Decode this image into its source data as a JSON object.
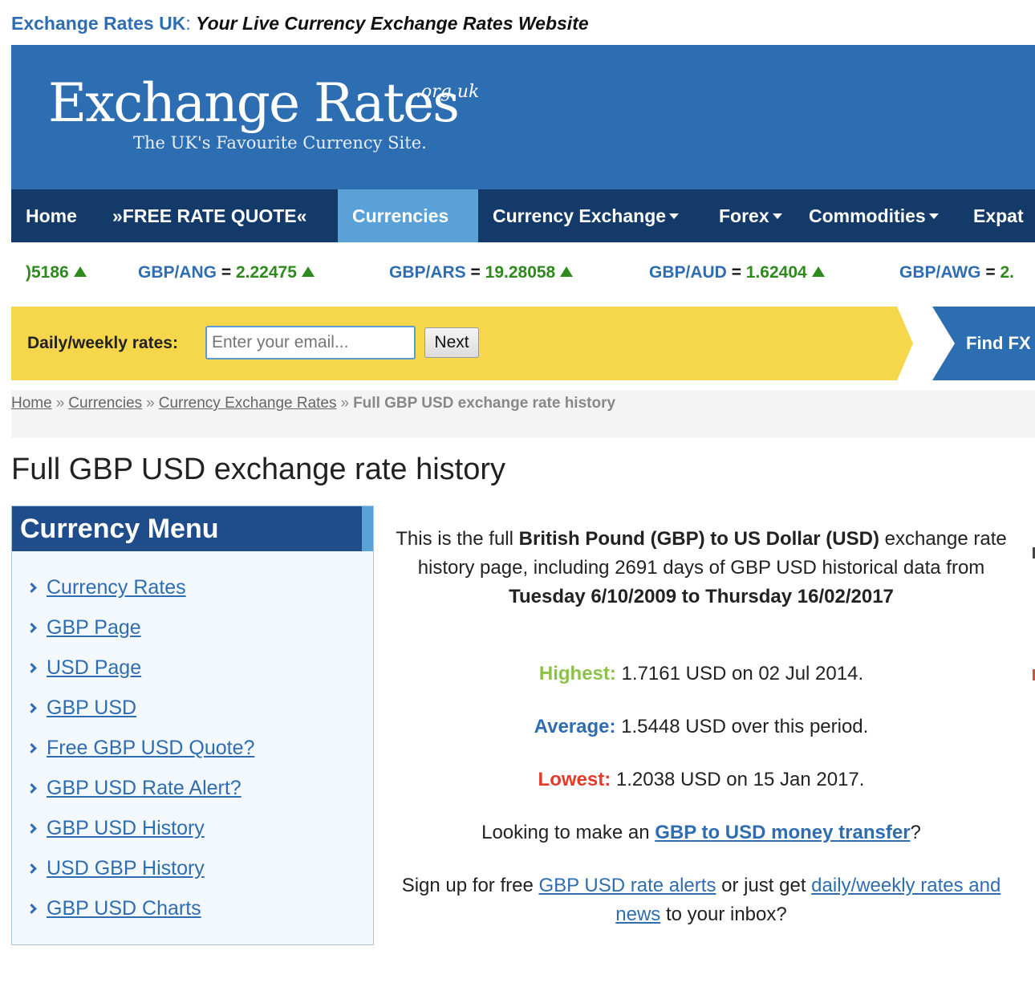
{
  "topline": {
    "site": "Exchange Rates UK",
    "colon": ":",
    "tagline": "Your Live Currency Exchange Rates Website"
  },
  "logo": {
    "main": "Exchange Rates",
    "sup": ".org.uk",
    "sub": "The UK's  Favourite Currency Site."
  },
  "nav": [
    {
      "label": "Home",
      "dropdown": false,
      "active": false
    },
    {
      "label": "»FREE RATE QUOTE«",
      "dropdown": false,
      "active": false
    },
    {
      "label": "Currencies",
      "dropdown": false,
      "active": true
    },
    {
      "label": "Currency Exchange",
      "dropdown": true,
      "active": false
    },
    {
      "label": "Forex",
      "dropdown": true,
      "active": false
    },
    {
      "label": "Commodities",
      "dropdown": true,
      "active": false
    },
    {
      "label": "Expat",
      "dropdown": false,
      "active": false
    }
  ],
  "ticker": [
    {
      "pair": "",
      "eq": "",
      "value": ")5186"
    },
    {
      "pair": "GBP/ANG",
      "eq": "=",
      "value": "2.22475"
    },
    {
      "pair": "GBP/ARS",
      "eq": "=",
      "value": "19.28058"
    },
    {
      "pair": "GBP/AUD",
      "eq": "=",
      "value": "1.62404"
    },
    {
      "pair": "GBP/AWG",
      "eq": "=",
      "value": "2."
    }
  ],
  "signup": {
    "label": "Daily/weekly rates:",
    "placeholder": "Enter your email...",
    "button": "Next",
    "findfx": "Find FX"
  },
  "breadcrumb": {
    "links": [
      "Home",
      "Currencies",
      "Currency Exchange Rates"
    ],
    "sep": "»",
    "current": "Full GBP USD exchange rate history"
  },
  "page_title": "Full GBP USD exchange rate history",
  "menu": {
    "title": "Currency Menu",
    "items": [
      "Currency Rates",
      "GBP Page",
      "USD Page",
      "GBP USD",
      "Free GBP USD Quote?",
      "GBP USD Rate Alert?",
      "GBP USD History",
      "USD GBP History",
      "GBP USD Charts"
    ]
  },
  "intro": {
    "p1": "This is the full ",
    "b1": "British Pound (GBP) to US Dollar (USD)",
    "p2": " exchange rate history page, including 2691 days of GBP USD historical data from ",
    "b2": "Tuesday 6/10/2009 to Thursday 16/02/2017"
  },
  "stats": {
    "highest_label": "Highest:",
    "highest_text": " 1.7161 USD on 02 Jul 2014.",
    "average_label": "Average:",
    "average_text": " 1.5448 USD over this period.",
    "lowest_label": "Lowest:",
    "lowest_text": " 1.2038 USD on 15 Jan 2017."
  },
  "transfer": {
    "pre": "Looking to make an ",
    "link": "GBP to USD money transfer",
    "post": "?"
  },
  "alerts": {
    "pre": "Sign up for free ",
    "link1": "GBP USD rate alerts",
    "mid": " or just get ",
    "link2": "daily/weekly rates and news",
    "post": " to your inbox?"
  },
  "colors": {
    "brand_blue": "#2d6eb2",
    "nav_bg": "#133a68",
    "nav_active": "#5aa1d8",
    "yellow": "#f6d64a",
    "up_green": "#2f8a1e",
    "high_green": "#8bc34a",
    "low_red": "#e53a2a"
  }
}
